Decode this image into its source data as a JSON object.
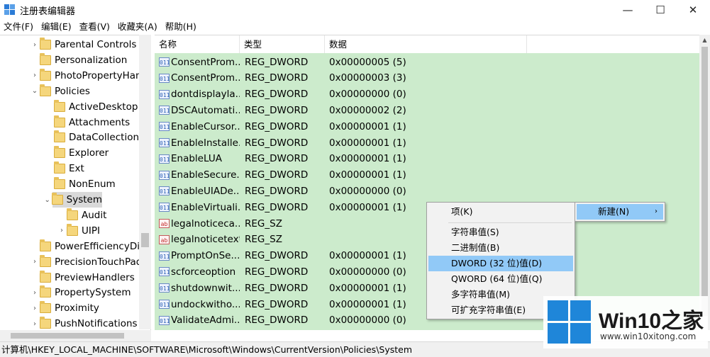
{
  "window": {
    "title": "注册表编辑器",
    "min_glyph": "—",
    "max_glyph": "☐",
    "close_glyph": "✕",
    "icon": "regedit-icon"
  },
  "menu": [
    "文件(F)",
    "编辑(E)",
    "查看(V)",
    "收藏夹(A)",
    "帮助(H)"
  ],
  "tree": [
    {
      "label": "Parental Controls",
      "indent": 0,
      "arrow": "›"
    },
    {
      "label": "Personalization",
      "indent": 0,
      "arrow": ""
    },
    {
      "label": "PhotoPropertyHan",
      "indent": 0,
      "arrow": "›"
    },
    {
      "label": "Policies",
      "indent": 0,
      "arrow": "⌄"
    },
    {
      "label": "ActiveDesktop",
      "indent": 1,
      "arrow": ""
    },
    {
      "label": "Attachments",
      "indent": 1,
      "arrow": ""
    },
    {
      "label": "DataCollection",
      "indent": 1,
      "arrow": ""
    },
    {
      "label": "Explorer",
      "indent": 1,
      "arrow": ""
    },
    {
      "label": "Ext",
      "indent": 1,
      "arrow": ""
    },
    {
      "label": "NonEnum",
      "indent": 1,
      "arrow": ""
    },
    {
      "label": "System",
      "indent": 1,
      "arrow": "⌄",
      "selected": true
    },
    {
      "label": "Audit",
      "indent": 2,
      "arrow": ""
    },
    {
      "label": "UIPI",
      "indent": 2,
      "arrow": "›"
    },
    {
      "label": "PowerEfficiencyDia",
      "indent": 0,
      "arrow": ""
    },
    {
      "label": "PrecisionTouchPad",
      "indent": 0,
      "arrow": "›"
    },
    {
      "label": "PreviewHandlers",
      "indent": 0,
      "arrow": ""
    },
    {
      "label": "PropertySystem",
      "indent": 0,
      "arrow": "›"
    },
    {
      "label": "Proximity",
      "indent": 0,
      "arrow": "›"
    },
    {
      "label": "PushNotifications",
      "indent": 0,
      "arrow": "›"
    }
  ],
  "list": {
    "columns": [
      "名称",
      "类型",
      "数据"
    ],
    "rows": [
      {
        "name": "ConsentProm...",
        "type": "REG_DWORD",
        "data": "0x00000005 (5)",
        "kind": "dword"
      },
      {
        "name": "ConsentProm...",
        "type": "REG_DWORD",
        "data": "0x00000003 (3)",
        "kind": "dword"
      },
      {
        "name": "dontdisplayla...",
        "type": "REG_DWORD",
        "data": "0x00000000 (0)",
        "kind": "dword"
      },
      {
        "name": "DSCAutomati...",
        "type": "REG_DWORD",
        "data": "0x00000002 (2)",
        "kind": "dword"
      },
      {
        "name": "EnableCursor...",
        "type": "REG_DWORD",
        "data": "0x00000001 (1)",
        "kind": "dword"
      },
      {
        "name": "EnableInstalle...",
        "type": "REG_DWORD",
        "data": "0x00000001 (1)",
        "kind": "dword"
      },
      {
        "name": "EnableLUA",
        "type": "REG_DWORD",
        "data": "0x00000001 (1)",
        "kind": "dword"
      },
      {
        "name": "EnableSecure...",
        "type": "REG_DWORD",
        "data": "0x00000001 (1)",
        "kind": "dword"
      },
      {
        "name": "EnableUIADe...",
        "type": "REG_DWORD",
        "data": "0x00000000 (0)",
        "kind": "dword"
      },
      {
        "name": "EnableVirtuali...",
        "type": "REG_DWORD",
        "data": "0x00000001 (1)",
        "kind": "dword"
      },
      {
        "name": "legalnoticeca...",
        "type": "REG_SZ",
        "data": "",
        "kind": "sz"
      },
      {
        "name": "legalnoticetext",
        "type": "REG_SZ",
        "data": "",
        "kind": "sz"
      },
      {
        "name": "PromptOnSe...",
        "type": "REG_DWORD",
        "data": "0x00000001 (1)",
        "kind": "dword"
      },
      {
        "name": "scforceoption",
        "type": "REG_DWORD",
        "data": "0x00000000 (0)",
        "kind": "dword"
      },
      {
        "name": "shutdownwit...",
        "type": "REG_DWORD",
        "data": "0x00000001 (1)",
        "kind": "dword"
      },
      {
        "name": "undockwitho...",
        "type": "REG_DWORD",
        "data": "0x00000001 (1)",
        "kind": "dword"
      },
      {
        "name": "ValidateAdmi...",
        "type": "REG_DWORD",
        "data": "0x00000000 (0)",
        "kind": "dword"
      }
    ]
  },
  "status_path": "计算机\\HKEY_LOCAL_MACHINE\\SOFTWARE\\Microsoft\\Windows\\CurrentVersion\\Policies\\System",
  "context_menu": {
    "key_item": "项(K)",
    "value_items": [
      "字符串值(S)",
      "二进制值(B)",
      "DWORD (32 位)值(D)",
      "QWORD (64 位)值(Q)",
      "多字符串值(M)",
      "可扩充字符串值(E)"
    ],
    "highlighted": "DWORD (32 位)值(D)"
  },
  "submenu": {
    "label": "新建(N)",
    "arrow": "›"
  },
  "watermark": {
    "brand": "Win10",
    "brand_suffix": "之家",
    "url": "www.win10xitong.com"
  },
  "colors": {
    "list_bg": "#ccebcc",
    "menu_highlight": "#91c9f7",
    "logo_blue": "#1f86d9"
  }
}
